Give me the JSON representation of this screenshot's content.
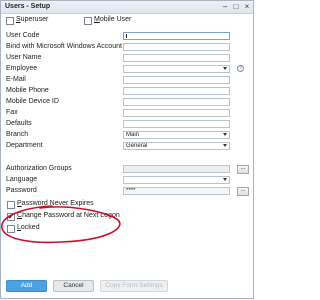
{
  "window": {
    "title": "Users - Setup",
    "minimize_glyph": "–",
    "maximize_glyph": "□",
    "close_glyph": "×"
  },
  "top_checkboxes": [
    {
      "label_underlined": "S",
      "label_rest": "uperuser",
      "checked": false
    },
    {
      "label_underlined": "M",
      "label_rest": "obile User",
      "checked": false
    }
  ],
  "fields": {
    "user_code": {
      "label": "User Code",
      "value": ""
    },
    "bind_account": {
      "label": "Bind with Microsoft Windows Account",
      "value": ""
    },
    "user_name": {
      "label": "User Name",
      "value": ""
    },
    "employee": {
      "label": "Employee",
      "value": ""
    },
    "email": {
      "label": "E-Mail",
      "value": ""
    },
    "mobile_phone": {
      "label": "Mobile Phone",
      "value": ""
    },
    "mobile_device_id": {
      "label": "Mobile Device ID",
      "value": ""
    },
    "fax": {
      "label": "Fax",
      "value": ""
    },
    "defaults": {
      "label": "Defaults",
      "value": ""
    },
    "branch": {
      "label": "Branch",
      "value": "Main"
    },
    "department": {
      "label": "Department",
      "value": "General"
    },
    "authorization_groups": {
      "label": "Authorization Groups",
      "value": ""
    },
    "language": {
      "label": "Language",
      "value": ""
    },
    "password": {
      "label": "Password",
      "value": "****"
    }
  },
  "ellipsis_label": "...",
  "info_glyph": "?",
  "bottom_checkboxes": [
    {
      "label_underlined": "P",
      "label_rest": "assword Never Expires",
      "checked": false
    },
    {
      "label_underlined": "C",
      "label_rest": "hange Password at Next Logon",
      "checked": true
    },
    {
      "label_underlined": "L",
      "label_rest": "ocked",
      "checked": false
    }
  ],
  "buttons": {
    "add": "Add",
    "cancel": "Cancel",
    "copy_form_settings": "Copy Form Settings"
  },
  "colors": {
    "accent": "#4ea1e3",
    "annotation_circle": "#c8102e"
  }
}
